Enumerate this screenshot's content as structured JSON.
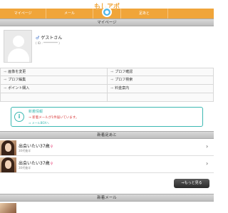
{
  "header": {
    "logo": "もしアポ",
    "nav": [
      "マイページ",
      "メール",
      "",
      "足あと",
      ""
    ]
  },
  "mypage": {
    "section_title": "マイページ",
    "user_name": "ゲストさん",
    "user_id": "( ID : ********** )",
    "menu": [
      "画像を変更",
      "プロフ確認",
      "プロフ編集",
      "プロフ検索",
      "ポイント購入",
      "料金案内",
      "",
      ""
    ]
  },
  "notice": {
    "title": "新着情報",
    "text": "→ 新着メールが1件届いています。",
    "link": "⇒ メールBOXへ"
  },
  "footprints": {
    "section_title": "新着足あと",
    "rows": [
      {
        "name": "出会いたい37歳",
        "sub": "30代後半"
      },
      {
        "name": "出会いたい37歳",
        "sub": "30代後半"
      }
    ],
    "more_label": "⇒もっと見る"
  },
  "mail": {
    "section_title": "新着メール"
  },
  "colors": {
    "accent": "#f0a53a",
    "notice": "#3cb8b2",
    "alert": "#d83a3a"
  }
}
